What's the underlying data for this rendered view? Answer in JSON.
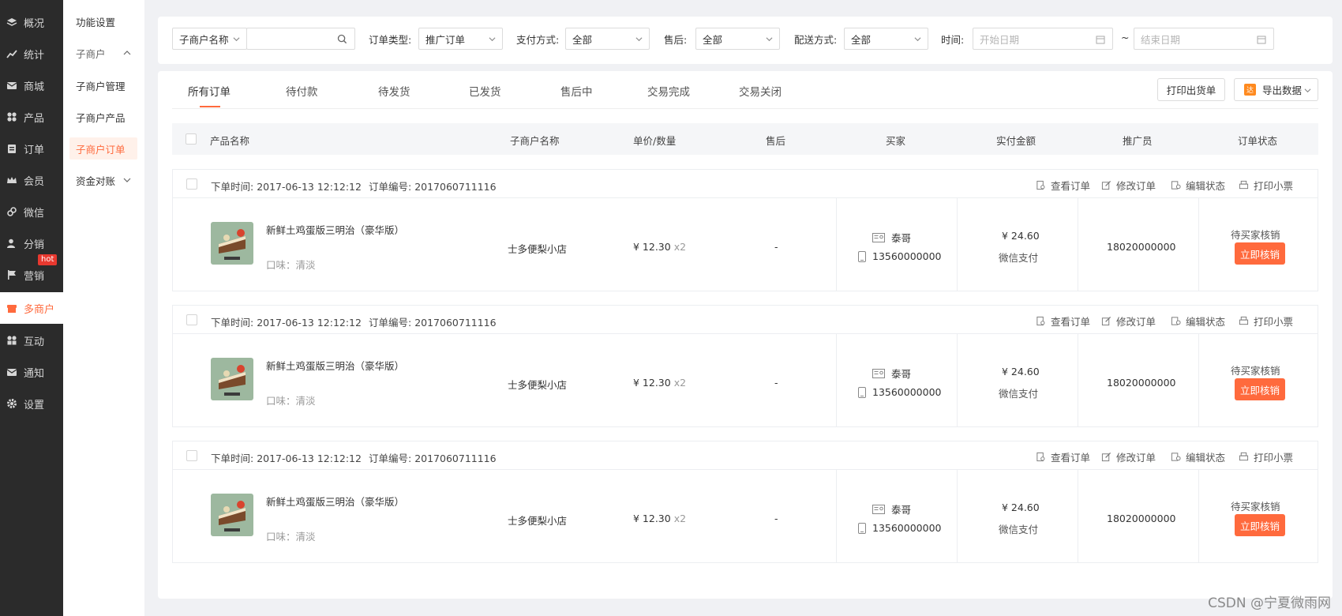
{
  "nav": {
    "items": [
      {
        "label": "概况",
        "icon": "layers-icon"
      },
      {
        "label": "统计",
        "icon": "chart-icon"
      },
      {
        "label": "商城",
        "icon": "mail-icon"
      },
      {
        "label": "产品",
        "icon": "grid-icon"
      },
      {
        "label": "订单",
        "icon": "clipboard-icon"
      },
      {
        "label": "会员",
        "icon": "crown-icon"
      },
      {
        "label": "微信",
        "icon": "link-icon"
      },
      {
        "label": "分销",
        "icon": "user-icon"
      },
      {
        "label": "营销",
        "icon": "flag-icon",
        "badge": "hot"
      },
      {
        "label": "多商户",
        "icon": "store-icon",
        "active": true
      },
      {
        "label": "互动",
        "icon": "apps-icon"
      },
      {
        "label": "通知",
        "icon": "envelope-icon"
      },
      {
        "label": "设置",
        "icon": "gear-icon"
      }
    ]
  },
  "subnav": {
    "function_settings": "功能设置",
    "group_label": "子商户",
    "items": [
      "子商户管理",
      "子商户产品",
      "子商户订单"
    ],
    "settlement": "资金对账"
  },
  "filters": {
    "merchant_select": "子商户名称",
    "search_value": "",
    "order_type_label": "订单类型:",
    "order_type_value": "推广订单",
    "payment_label": "支付方式:",
    "payment_value": "全部",
    "aftersale_label": "售后:",
    "aftersale_value": "全部",
    "delivery_label": "配送方式:",
    "delivery_value": "全部",
    "time_label": "时间:",
    "start_placeholder": "开始日期",
    "range_sep": "~",
    "end_placeholder": "结束日期"
  },
  "tabs": [
    "所有订单",
    "待付款",
    "待发货",
    "已发货",
    "售后中",
    "交易完成",
    "交易关闭"
  ],
  "toolbar": {
    "print_label": "打印出货单",
    "export_label": "导出数据",
    "export_badge": "达"
  },
  "table": {
    "headers": [
      "产品名称",
      "子商户名称",
      "单价/数量",
      "售后",
      "买家",
      "实付金额",
      "推广员",
      "订单状态"
    ]
  },
  "order_labels": {
    "time_prefix": "下单时间:",
    "no_prefix": "订单编号:",
    "actions": [
      "查看订单",
      "修改订单",
      "编辑状态",
      "打印小票"
    ]
  },
  "orders": [
    {
      "time": "2017-06-13 12:12:12",
      "order_no": "2017060711116",
      "product": "新鲜土鸡蛋版三明治（豪华版）",
      "spec": "口味：清淡",
      "merchant": "士多便梨小店",
      "price": "¥ 12.30",
      "qty": "x2",
      "aftersale": "-",
      "buyer": "泰哥",
      "phone": "13560000000",
      "amount": "¥ 24.60",
      "pay_method": "微信支付",
      "promoter": "18020000000",
      "status": "待买家核销",
      "action": "立即核销"
    },
    {
      "time": "2017-06-13 12:12:12",
      "order_no": "2017060711116",
      "product": "新鲜土鸡蛋版三明治（豪华版）",
      "spec": "口味：清淡",
      "merchant": "士多便梨小店",
      "price": "¥ 12.30",
      "qty": "x2",
      "aftersale": "-",
      "buyer": "泰哥",
      "phone": "13560000000",
      "amount": "¥ 24.60",
      "pay_method": "微信支付",
      "promoter": "18020000000",
      "status": "待买家核销",
      "action": "立即核销"
    },
    {
      "time": "2017-06-13 12:12:12",
      "order_no": "2017060711116",
      "product": "新鲜土鸡蛋版三明治（豪华版）",
      "spec": "口味：清淡",
      "merchant": "士多便梨小店",
      "price": "¥ 12.30",
      "qty": "x2",
      "aftersale": "-",
      "buyer": "泰哥",
      "phone": "13560000000",
      "amount": "¥ 24.60",
      "pay_method": "微信支付",
      "promoter": "18020000000",
      "status": "待买家核销",
      "action": "立即核销"
    }
  ],
  "watermark": "CSDN @宁夏微雨网",
  "colors": {
    "accent": "#ff6a3d",
    "sidebar": "#2b2b2b",
    "background": "#f0f1f4"
  }
}
